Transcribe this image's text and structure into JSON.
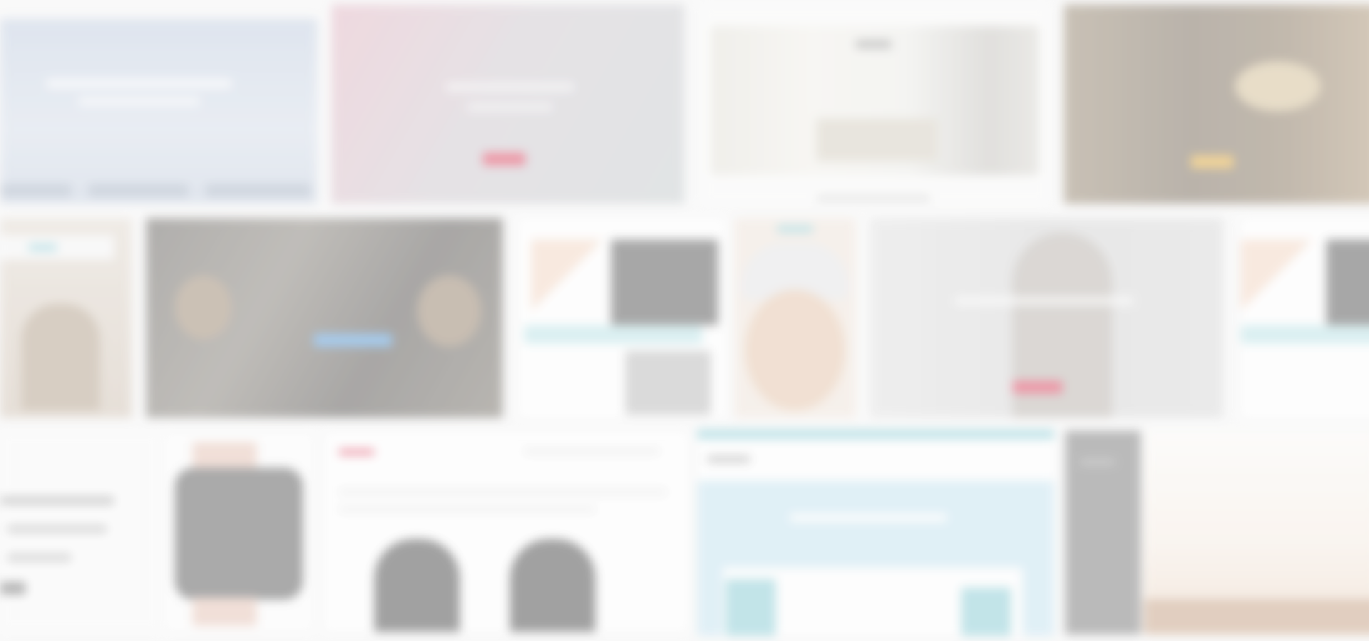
{
  "page": {
    "title": "",
    "background_color": "#f7f7f7"
  },
  "tiles": [
    {
      "name": "template-preview-1",
      "style": "blue-gradient-hero"
    },
    {
      "name": "template-preview-2",
      "style": "pink-grey-gradient-hero"
    },
    {
      "name": "template-preview-3",
      "style": "white-interior-photo"
    },
    {
      "name": "template-preview-4",
      "style": "dark-restaurant-photo"
    },
    {
      "name": "template-preview-5",
      "style": "beige-portrait-photo"
    },
    {
      "name": "template-preview-6",
      "style": "dark-crowd-photo"
    },
    {
      "name": "template-preview-7",
      "style": "white-fashion-layout"
    },
    {
      "name": "template-preview-8",
      "style": "face-closeup-photo"
    },
    {
      "name": "template-preview-9",
      "style": "grey-woman-portrait"
    },
    {
      "name": "template-preview-10",
      "style": "white-fashion-layout"
    },
    {
      "name": "template-preview-11",
      "style": "white-text-list"
    },
    {
      "name": "template-preview-12",
      "style": "smartwatch-product"
    },
    {
      "name": "template-preview-13",
      "style": "white-team-page"
    },
    {
      "name": "template-preview-14",
      "style": "light-blue-dashboard"
    },
    {
      "name": "template-preview-15",
      "style": "grey-sidebar-layout"
    },
    {
      "name": "template-preview-16",
      "style": "warm-sunset-photo"
    }
  ],
  "colors": {
    "pink_accent": "#e0405c",
    "blue_accent": "#5aa0e0",
    "teal_accent": "#8ecfd8",
    "gold_accent": "#e8b040",
    "dashboard_blue": "#c8e6f2"
  }
}
